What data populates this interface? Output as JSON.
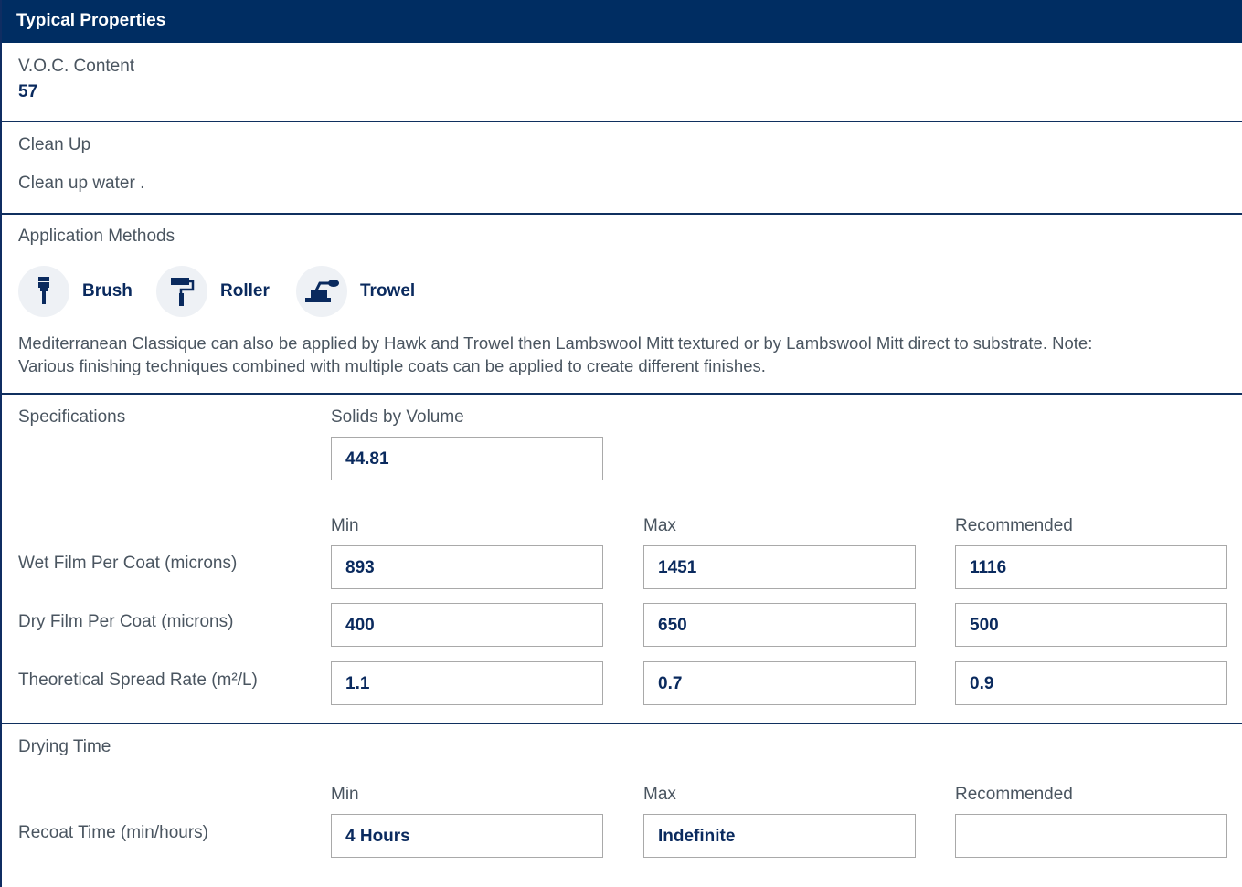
{
  "header": {
    "title": "Typical Properties"
  },
  "voc": {
    "label": "V.O.C. Content",
    "value": "57"
  },
  "cleanup": {
    "label": "Clean Up",
    "text": "Clean up water ."
  },
  "application": {
    "label": "Application Methods",
    "methods": [
      {
        "label": "Brush",
        "icon": "brush-icon"
      },
      {
        "label": "Roller",
        "icon": "roller-icon"
      },
      {
        "label": "Trowel",
        "icon": "trowel-icon"
      }
    ],
    "note_line1": "Mediterranean Classique can also be applied by Hawk and Trowel then Lambswool Mitt textured or by Lambswool Mitt direct to substrate. Note:",
    "note_line2": "Various finishing techniques combined with multiple coats can be applied to create different finishes."
  },
  "specifications": {
    "label": "Specifications",
    "solids_label": "Solids by Volume",
    "solids_value": "44.81",
    "col_min": "Min",
    "col_max": "Max",
    "col_recommended": "Recommended",
    "rows": [
      {
        "label": "Wet Film Per Coat (microns)",
        "min": "893",
        "max": "1451",
        "recommended": "1116"
      },
      {
        "label": "Dry Film Per Coat (microns)",
        "min": "400",
        "max": "650",
        "recommended": "500"
      },
      {
        "label": "Theoretical Spread Rate (m²/L)",
        "min": "1.1",
        "max": "0.7",
        "recommended": "0.9"
      }
    ]
  },
  "drying": {
    "label": "Drying Time",
    "col_min": "Min",
    "col_max": "Max",
    "col_recommended": "Recommended",
    "rows": [
      {
        "label": "Recoat Time (min/hours)",
        "min": "4 Hours",
        "max": "Indefinite",
        "recommended": ""
      }
    ]
  },
  "colors": {
    "header_bg": "#002d62",
    "value_text": "#0a2a5e",
    "divider": "#10305f",
    "icon_circle": "#eef1f5"
  }
}
